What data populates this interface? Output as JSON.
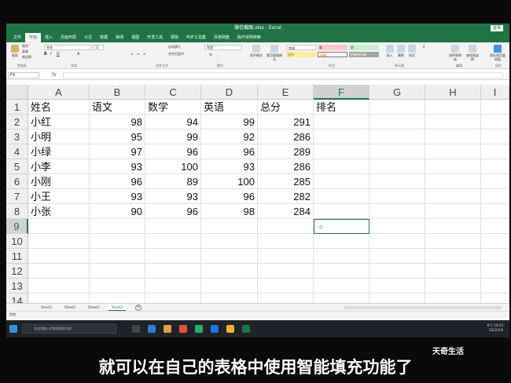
{
  "window": {
    "title": "微信截图.xlsx - Excel",
    "login_label": "登录"
  },
  "ribbon": {
    "tabs": [
      "文件",
      "开始",
      "插入",
      "页面布局",
      "公式",
      "数据",
      "审阅",
      "视图",
      "开发工具",
      "帮助",
      "PDF工具集",
      "百度网盘",
      "操作说明搜索"
    ],
    "active_tab": 1,
    "paste_label": "粘贴",
    "cut_label": "剪切",
    "copy_label": "复制",
    "format_painter_label": "格式刷",
    "font_name": "宋体",
    "font_size": "11",
    "wrap_text_label": "自动换行",
    "merge_center_label": "合并后居中",
    "number_format": "常规",
    "conditional_format_label": "条件格式",
    "table_format_label": "套用表格格式",
    "styles": {
      "normal": "常规",
      "bad": "差",
      "good": "好",
      "neutral": "适中",
      "calc": "计算",
      "check": "检查单元格"
    },
    "insert_label": "插入",
    "delete_label": "删除",
    "format_label": "格式",
    "sort_filter_label": "排序和筛选",
    "find_select_label": "查找和选择",
    "save_baidu_label": "保存到百度网盘",
    "group_labels": {
      "clipboard": "剪贴板",
      "font": "字体",
      "alignment": "对齐方式",
      "number": "数字",
      "styles": "样式",
      "cells": "单元格",
      "editing": "编辑",
      "save": "保存"
    }
  },
  "formula_bar": {
    "name_box": "F9",
    "fx": "fx",
    "value": ""
  },
  "grid": {
    "columns": [
      "A",
      "B",
      "C",
      "D",
      "E",
      "F",
      "G",
      "H",
      "I"
    ],
    "row_numbers": [
      "1",
      "2",
      "3",
      "4",
      "5",
      "6",
      "7",
      "8",
      "9",
      "10",
      "11",
      "12",
      "13",
      "14"
    ],
    "selected_column": "F",
    "selected_row": "9",
    "header": [
      "姓名",
      "语文",
      "数学",
      "英语",
      "总分",
      "排名"
    ],
    "rows": [
      [
        "小红",
        "98",
        "94",
        "99",
        "291"
      ],
      [
        "小明",
        "95",
        "99",
        "92",
        "286"
      ],
      [
        "小绿",
        "97",
        "96",
        "96",
        "289"
      ],
      [
        "小李",
        "93",
        "100",
        "93",
        "286"
      ],
      [
        "小刚",
        "96",
        "89",
        "100",
        "285"
      ],
      [
        "小王",
        "93",
        "93",
        "96",
        "282"
      ],
      [
        "小张",
        "90",
        "96",
        "98",
        "284"
      ]
    ],
    "active_cell": "F9",
    "active_cell_icon": "⬦"
  },
  "sheets": {
    "tabs": [
      "Sheet1",
      "Sheet2",
      "Sheet3",
      "Sheet4"
    ],
    "active_index": 3,
    "add_label": "+"
  },
  "status": {
    "text": "就绪"
  },
  "taskbar": {
    "search_placeholder": "在这里输入你要搜索的内容",
    "weather": "6°C",
    "time": "10:53",
    "date": "2022/1/6"
  },
  "overlay": {
    "watermark": "天奇生活",
    "subtitle": "就可以在自己的表格中使用智能填充功能了"
  }
}
